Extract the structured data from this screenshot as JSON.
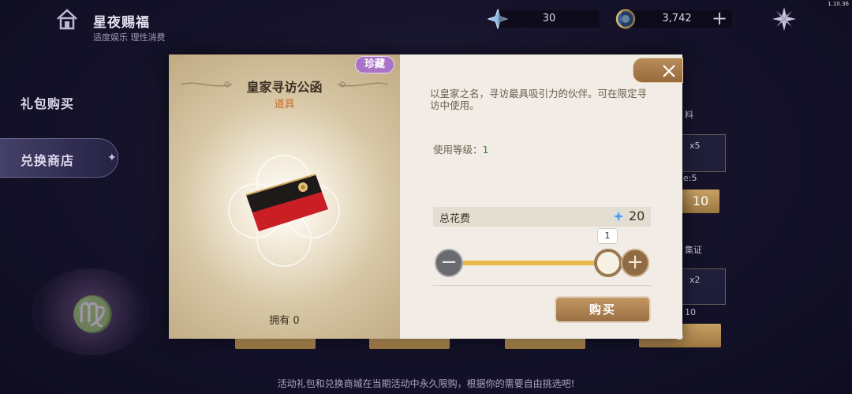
{
  "app": {
    "version": "1.10.36",
    "title": "星夜赐福",
    "subtitle": "适度娱乐 理性消费"
  },
  "currency": {
    "star_amount": "30",
    "coin_amount": "3,742"
  },
  "menu": {
    "items": [
      {
        "label": "礼包购买"
      },
      {
        "label": "兑换商店"
      }
    ]
  },
  "background": {
    "notice": "活动礼包和兑换商城在当期活动中永久限购，根据你的需要自由挑选吧!",
    "fragments": [
      "料",
      "x5",
      "e:5",
      "集证",
      "x2",
      "10"
    ],
    "prices": [
      "10",
      "10",
      "5"
    ]
  },
  "modal": {
    "badge": "珍藏",
    "item_name": "皇家寻访公函",
    "item_type": "道具",
    "owned_text": "拥有 0",
    "description": "以皇家之名，寻访最具吸引力的伙伴。可在限定寻访中使用。",
    "level_label": "使用等级：",
    "level_value": "1",
    "cost_label": "总花费",
    "cost_value": "20",
    "quantity": "1",
    "quantity_fraction": 1.0,
    "buy_label": "购买"
  },
  "colors": {
    "rare_badge": "#a973c7",
    "item_type": "#c9692c",
    "level_value": "#2f8a2b",
    "slider": "#e8b94a",
    "button": "#a87c4c"
  },
  "icons": [
    "home-icon",
    "star-currency-icon",
    "coin-currency-icon",
    "plus-icon",
    "compass-star-icon",
    "close-icon",
    "diamond-currency-icon",
    "minus-icon",
    "plus-icon"
  ]
}
